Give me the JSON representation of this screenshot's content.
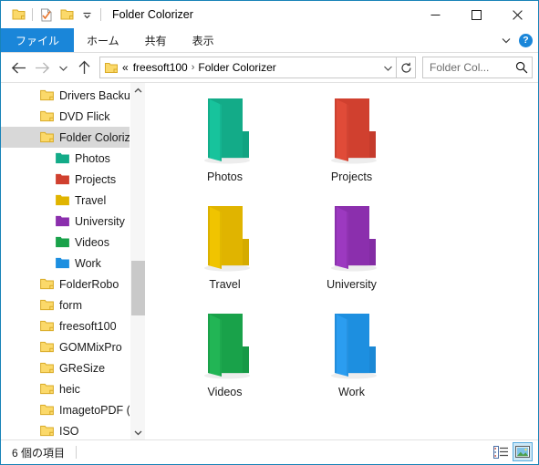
{
  "window": {
    "title": "Folder Colorizer",
    "border_color": "#1883b8",
    "quick_access": [
      {
        "name": "folder-icon",
        "label": "Folder"
      },
      {
        "name": "properties-icon",
        "label": "Properties"
      },
      {
        "name": "new-folder-icon",
        "label": "New folder"
      },
      {
        "name": "customize-dropdown-icon",
        "label": "Customize Quick Access Toolbar"
      }
    ],
    "controls": {
      "minimize": "—",
      "maximize": "☐",
      "close": "✕"
    }
  },
  "ribbon": {
    "tabs": [
      {
        "label": "ファイル",
        "active": true
      },
      {
        "label": "ホーム",
        "active": false
      },
      {
        "label": "共有",
        "active": false
      },
      {
        "label": "表示",
        "active": false
      }
    ],
    "expand_icon": "chevron-down-icon",
    "help_label": "?",
    "accent_color": "#1a86d9"
  },
  "addressbar": {
    "back_icon": "arrow-left-icon",
    "forward_icon": "arrow-right-icon",
    "recent_icon": "chevron-down-icon",
    "up_icon": "arrow-up-icon",
    "overflow": "«",
    "crumbs": [
      "freesoft100",
      "Folder Colorizer"
    ],
    "separator": "›",
    "dropdown_icon": "chevron-down-icon",
    "refresh_icon": "refresh-icon"
  },
  "search": {
    "placeholder": "Folder Col...",
    "icon": "search-icon"
  },
  "navpane": {
    "scroll_up_icon": "chevron-up-icon",
    "scroll_down_icon": "chevron-down-icon",
    "items": [
      {
        "label": "Drivers Backu",
        "indent": 1,
        "color": "#fbd96a",
        "selected": false
      },
      {
        "label": "DVD Flick",
        "indent": 1,
        "color": "#fbd96a",
        "selected": false
      },
      {
        "label": "Folder Coloriz",
        "indent": 1,
        "color": "#fbd96a",
        "selected": true
      },
      {
        "label": "Photos",
        "indent": 2,
        "color": "#13ab88",
        "selected": false
      },
      {
        "label": "Projects",
        "indent": 2,
        "color": "#d0402f",
        "selected": false
      },
      {
        "label": "Travel",
        "indent": 2,
        "color": "#e0b400",
        "selected": false
      },
      {
        "label": "University",
        "indent": 2,
        "color": "#8b2fad",
        "selected": false
      },
      {
        "label": "Videos",
        "indent": 2,
        "color": "#19a24a",
        "selected": false
      },
      {
        "label": "Work",
        "indent": 2,
        "color": "#1d8fe0",
        "selected": false
      },
      {
        "label": "FolderRobo",
        "indent": 1,
        "color": "#fbd96a",
        "selected": false
      },
      {
        "label": "form",
        "indent": 1,
        "color": "#fbd96a",
        "selected": false
      },
      {
        "label": "freesoft100",
        "indent": 1,
        "color": "#fbd96a",
        "selected": false
      },
      {
        "label": "GOMMixPro",
        "indent": 1,
        "color": "#fbd96a",
        "selected": false
      },
      {
        "label": "GReSize",
        "indent": 1,
        "color": "#fbd96a",
        "selected": false
      },
      {
        "label": "heic",
        "indent": 1,
        "color": "#fbd96a",
        "selected": false
      },
      {
        "label": "ImagetoPDF (",
        "indent": 1,
        "color": "#fbd96a",
        "selected": false
      },
      {
        "label": "ISO",
        "indent": 1,
        "color": "#fbd96a",
        "selected": false
      }
    ]
  },
  "content": {
    "folders": [
      {
        "name": "Photos",
        "color": "#13ab88",
        "flap_color": "#17c39c",
        "side_color": "#0f9476"
      },
      {
        "name": "Projects",
        "color": "#d0402f",
        "flap_color": "#e04b38",
        "side_color": "#b33527"
      },
      {
        "name": "Travel",
        "color": "#e0b400",
        "flap_color": "#f0c400",
        "side_color": "#c09c00"
      },
      {
        "name": "University",
        "color": "#8b2fad",
        "flap_color": "#9c39c0",
        "side_color": "#762795"
      },
      {
        "name": "Videos",
        "color": "#19a24a",
        "flap_color": "#22b555",
        "side_color": "#158a3f"
      },
      {
        "name": "Work",
        "color": "#1d8fe0",
        "flap_color": "#2b9df0",
        "side_color": "#197bc0"
      }
    ]
  },
  "statusbar": {
    "item_count": "6 個の項目",
    "views": [
      {
        "name": "details-view-button",
        "active": false
      },
      {
        "name": "large-icons-view-button",
        "active": true
      }
    ]
  }
}
